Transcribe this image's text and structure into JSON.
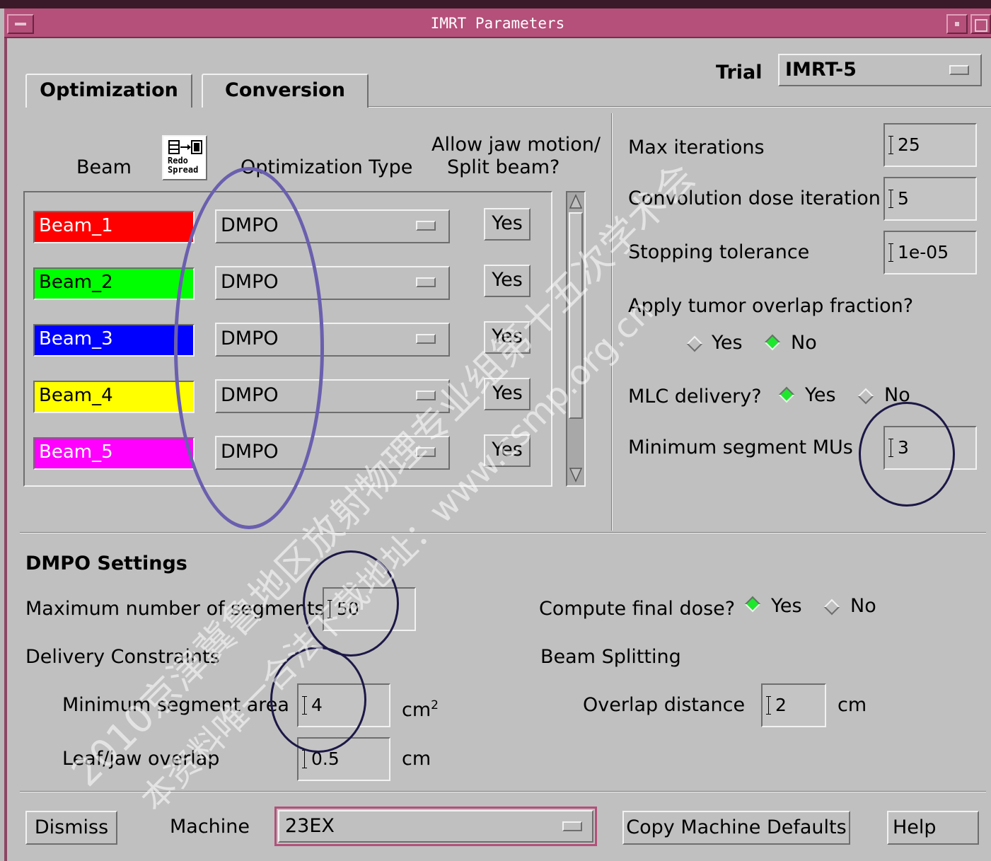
{
  "window": {
    "title": "IMRT Parameters"
  },
  "tabs": [
    {
      "label": "Optimization"
    },
    {
      "label": "Conversion"
    }
  ],
  "trial": {
    "label": "Trial",
    "value": "IMRT-5"
  },
  "beam_table": {
    "col_beam": "Beam",
    "redo_spread": {
      "line1": "Redo",
      "line2": "Spread"
    },
    "col_opt_type": "Optimization Type",
    "col_jaw_line1": "Allow jaw motion/",
    "col_jaw_line2": "Split beam?",
    "rows": [
      {
        "name": "Beam_1",
        "color": "#ff0000",
        "text_color": "#ffffff",
        "opt_type": "DMPO",
        "jaw": "Yes"
      },
      {
        "name": "Beam_2",
        "color": "#00ff00",
        "text_color": "#000000",
        "opt_type": "DMPO",
        "jaw": "Yes"
      },
      {
        "name": "Beam_3",
        "color": "#0000ff",
        "text_color": "#ffffff",
        "opt_type": "DMPO",
        "jaw": "Yes"
      },
      {
        "name": "Beam_4",
        "color": "#ffff00",
        "text_color": "#000000",
        "opt_type": "DMPO",
        "jaw": "Yes"
      },
      {
        "name": "Beam_5",
        "color": "#ff00ff",
        "text_color": "#ffffff",
        "opt_type": "DMPO",
        "jaw": "Yes"
      }
    ]
  },
  "params": {
    "max_iterations": {
      "label": "Max iterations",
      "value": "25"
    },
    "conv_dose_iter": {
      "label": "Convolution dose iteration",
      "value": "5"
    },
    "stop_tol": {
      "label": "Stopping tolerance",
      "value": "1e-05"
    },
    "tumor_overlap": {
      "label": "Apply tumor overlap fraction?",
      "yes": "Yes",
      "no": "No",
      "selected": "No"
    },
    "mlc_delivery": {
      "label": "MLC delivery?",
      "yes": "Yes",
      "no": "No",
      "selected": "Yes"
    },
    "min_seg_mu": {
      "label": "Minimum segment MUs",
      "value": "3"
    }
  },
  "dmpo": {
    "heading": "DMPO Settings",
    "max_segments": {
      "label": "Maximum number of segments",
      "value": "50"
    },
    "delivery_constraints": "Delivery Constraints",
    "min_seg_area": {
      "label": "Minimum segment area",
      "value": "4",
      "unit": "cm",
      "unit_sup": "2"
    },
    "leaf_jaw_overlap": {
      "label": "Leaf/jaw overlap",
      "value": "0.5",
      "unit": "cm"
    },
    "compute_final_dose": {
      "label": "Compute final dose?",
      "yes": "Yes",
      "no": "No",
      "selected": "Yes"
    },
    "beam_splitting": "Beam Splitting",
    "overlap_distance": {
      "label": "Overlap distance",
      "value": "2",
      "unit": "cm"
    }
  },
  "bottom": {
    "dismiss": "Dismiss",
    "machine_label": "Machine",
    "machine_value": "23EX",
    "copy_defaults": "Copy Machine Defaults",
    "help": "Help"
  },
  "watermark": {
    "line1": "2010京津冀鲁地区放射物理专业组第十五次学术会",
    "line2": "本资料唯一合法下载地址：www.csmp.org.cn"
  },
  "colors": {
    "titlebar": "#b4507a",
    "radio_on": "#1ee82c",
    "annotation": "#6a5fae"
  }
}
